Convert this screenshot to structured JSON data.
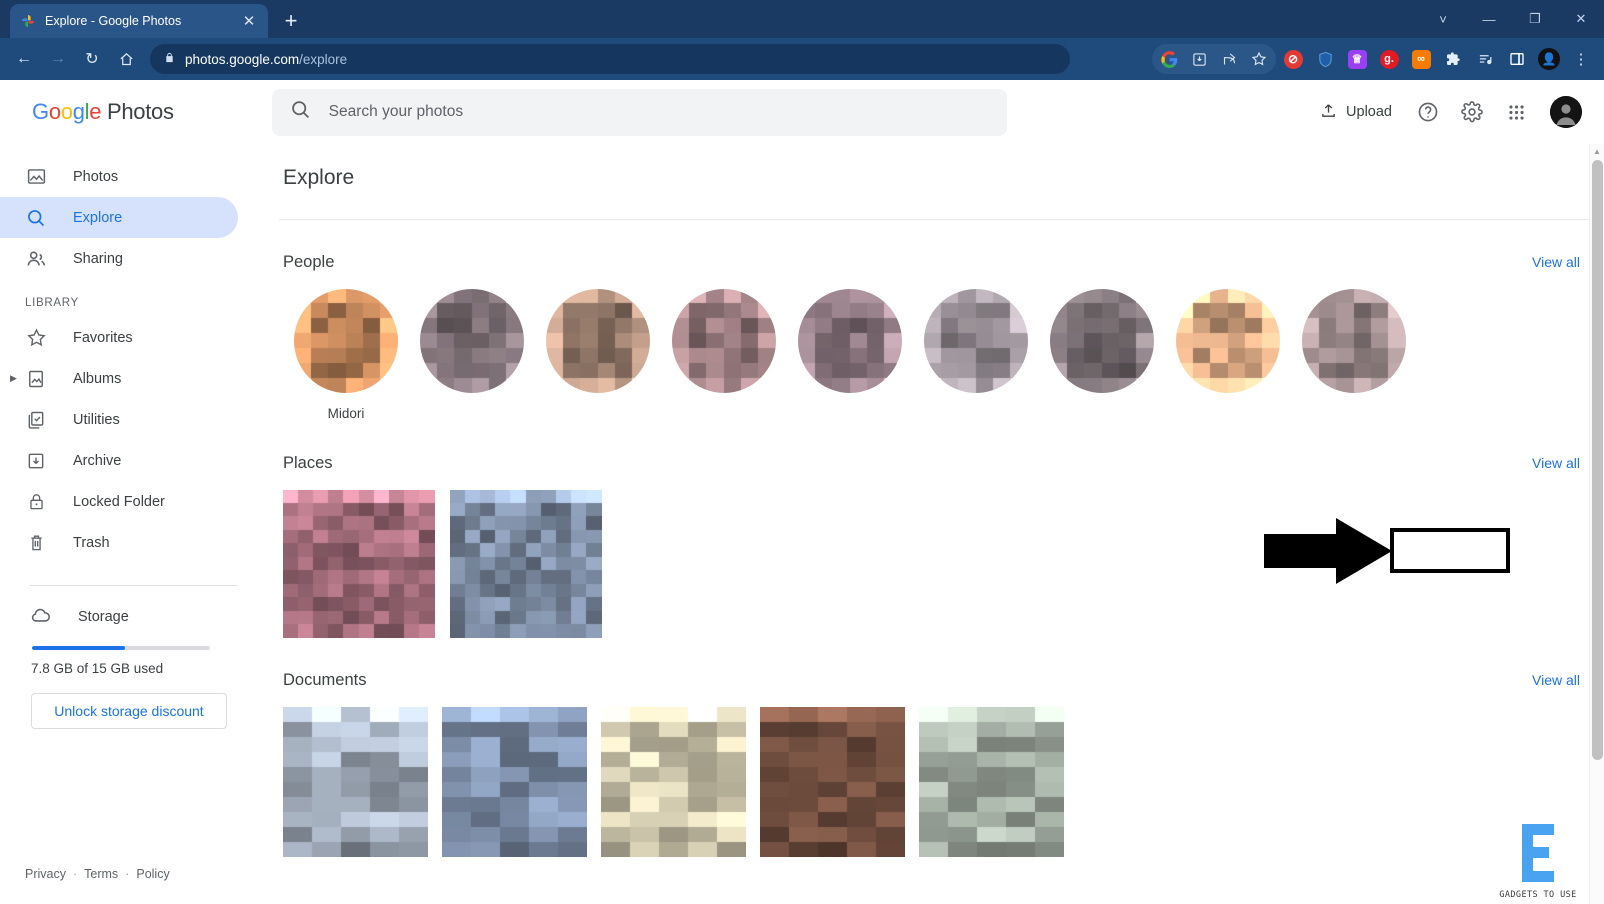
{
  "browser": {
    "tab": {
      "title": "Explore - Google Photos",
      "favicon": "google-photos-pinwheel-icon",
      "close": "✕"
    },
    "newtab_label": "+",
    "window_controls": {
      "minimize_chevron": "˅",
      "minimize": "—",
      "maximize": "❐",
      "close": "✕"
    },
    "nav": {
      "back": "←",
      "forward": "→",
      "reload": "↻",
      "home": "⌂"
    },
    "omnibox": {
      "lock": "🔒",
      "host": "photos.google.com",
      "path": "/explore"
    },
    "toolbar_icons": [
      {
        "name": "google-profile-icon",
        "glyph": "G"
      },
      {
        "name": "install-app-icon",
        "glyph": "⤓"
      },
      {
        "name": "share-icon",
        "glyph": "⤴"
      },
      {
        "name": "bookmark-star-icon",
        "glyph": "☆"
      },
      {
        "name": "adblock-extension-icon",
        "glyph": "⊘",
        "color": "#e53935"
      },
      {
        "name": "vpn-shield-extension-icon",
        "glyph": "⛨",
        "color": "#1565c0"
      },
      {
        "name": "grammar-extension-icon",
        "glyph": "W",
        "color": "#8e44ef"
      },
      {
        "name": "g-extension-icon",
        "glyph": "g.",
        "color": "#e01b24"
      },
      {
        "name": "orange-extension-icon",
        "glyph": "∞",
        "color": "#f57c00"
      },
      {
        "name": "extensions-puzzle-icon",
        "glyph": "🧩"
      },
      {
        "name": "reading-list-icon",
        "glyph": "≡"
      },
      {
        "name": "side-panel-icon",
        "glyph": "▣"
      },
      {
        "name": "chrome-profile-avatar",
        "glyph": "●"
      }
    ]
  },
  "app": {
    "logo": {
      "g1": "G",
      "o1": "o",
      "o2": "o",
      "g2": "g",
      "l": "l",
      "e": "e",
      "product": " Photos"
    },
    "search": {
      "placeholder": "Search your photos",
      "icon": "search-icon"
    },
    "actions": {
      "upload_label": "Upload",
      "upload_icon": "upload-icon",
      "help_icon": "help-circle-icon",
      "settings_icon": "gear-icon",
      "apps_icon": "apps-grid-icon",
      "avatar_icon": "account-avatar"
    }
  },
  "sidebar": {
    "items": [
      {
        "label": "Photos",
        "icon": "photo-icon",
        "active": false
      },
      {
        "label": "Explore",
        "icon": "search-icon",
        "active": true
      },
      {
        "label": "Sharing",
        "icon": "people-share-icon",
        "active": false
      }
    ],
    "library_label": "LIBRARY",
    "library_items": [
      {
        "label": "Favorites",
        "icon": "star-outline-icon",
        "caret": false
      },
      {
        "label": "Albums",
        "icon": "album-icon",
        "caret": true
      },
      {
        "label": "Utilities",
        "icon": "utilities-check-icon",
        "caret": false
      },
      {
        "label": "Archive",
        "icon": "archive-down-arrow-icon",
        "caret": false
      },
      {
        "label": "Locked Folder",
        "icon": "lock-icon",
        "caret": false
      },
      {
        "label": "Trash",
        "icon": "trash-icon",
        "caret": false
      }
    ],
    "storage": {
      "label": "Storage",
      "icon": "cloud-icon",
      "used_text": "7.8 GB of 15 GB used",
      "percent": 52,
      "unlock_label": "Unlock storage discount",
      "bar_color": "#1a73e8"
    },
    "footer": {
      "privacy": "Privacy",
      "terms": "Terms",
      "policy": "Policy",
      "separator": "·"
    }
  },
  "main": {
    "title": "Explore",
    "sections": [
      {
        "title": "People",
        "view_all": "View all",
        "type": "faces",
        "named_item": "Midori",
        "tiles": [
          {
            "seed": 11,
            "base": "#b07a52"
          },
          {
            "seed": 23,
            "base": "#6f6368"
          },
          {
            "seed": 37,
            "base": "#8f7566"
          },
          {
            "seed": 41,
            "base": "#8a6f72"
          },
          {
            "seed": 59,
            "base": "#7d6a72"
          },
          {
            "seed": 67,
            "base": "#8a8288"
          },
          {
            "seed": 73,
            "base": "#6d6468"
          },
          {
            "seed": 89,
            "base": "#c79a78"
          },
          {
            "seed": 97,
            "base": "#8a7a7c"
          }
        ]
      },
      {
        "title": "Places",
        "view_all": "View all",
        "type": "places",
        "annotated": true,
        "tiles": [
          {
            "seed": 101,
            "base": "#a8707f"
          },
          {
            "seed": 113,
            "base": "#7d8ca3"
          }
        ]
      },
      {
        "title": "Documents",
        "view_all": "View all",
        "type": "documents",
        "tiles": [
          {
            "seed": 127,
            "base": "#9aa4b2"
          },
          {
            "seed": 131,
            "base": "#76869f"
          },
          {
            "seed": 149,
            "base": "#c6bfa6"
          },
          {
            "seed": 157,
            "base": "#6b4a3c"
          },
          {
            "seed": 163,
            "base": "#9aa49a"
          }
        ]
      }
    ]
  },
  "annotation": {
    "arrow_color": "#000000",
    "box_color": "#000000",
    "points_to": "places-view-all-link"
  },
  "watermark": {
    "text": "GADGETS TO USE",
    "color": "#4aa3f0"
  }
}
